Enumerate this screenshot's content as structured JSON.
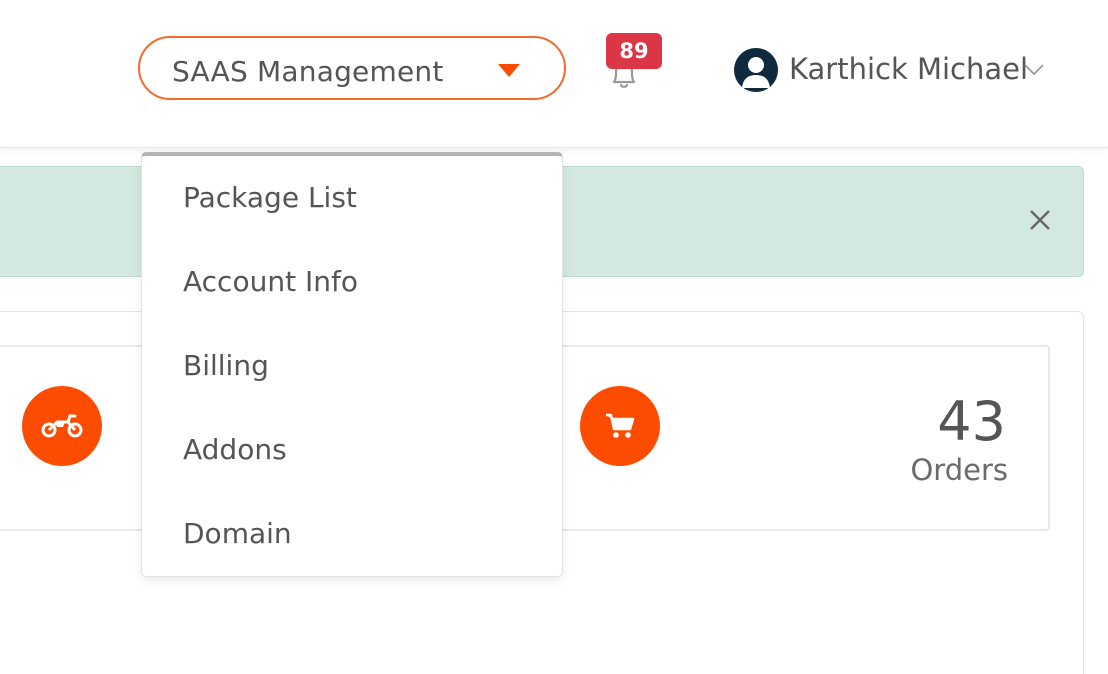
{
  "header": {
    "module_select": {
      "label": "SAAS Management",
      "icon": "caret-down-icon"
    },
    "notifications": {
      "count": "89",
      "icon": "bell-icon"
    },
    "user": {
      "name": "Karthick Michael",
      "icon": "chevron-down-icon"
    }
  },
  "alert": {
    "close_icon": "close-icon"
  },
  "stats": [
    {
      "icon": "motorcycle-icon"
    },
    {
      "icon": "cart-icon",
      "value": "43",
      "label": "Orders"
    }
  ],
  "dropdown": {
    "items": [
      {
        "label": "Package List"
      },
      {
        "label": "Account Info"
      },
      {
        "label": "Billing"
      },
      {
        "label": "Addons"
      },
      {
        "label": "Domain"
      }
    ]
  },
  "colors": {
    "accent": "#f4692b",
    "icon_circle": "#fc4c02",
    "badge": "#dc3545",
    "alert_bg": "#d3e8de",
    "avatar_bg": "#0f2a3f"
  }
}
